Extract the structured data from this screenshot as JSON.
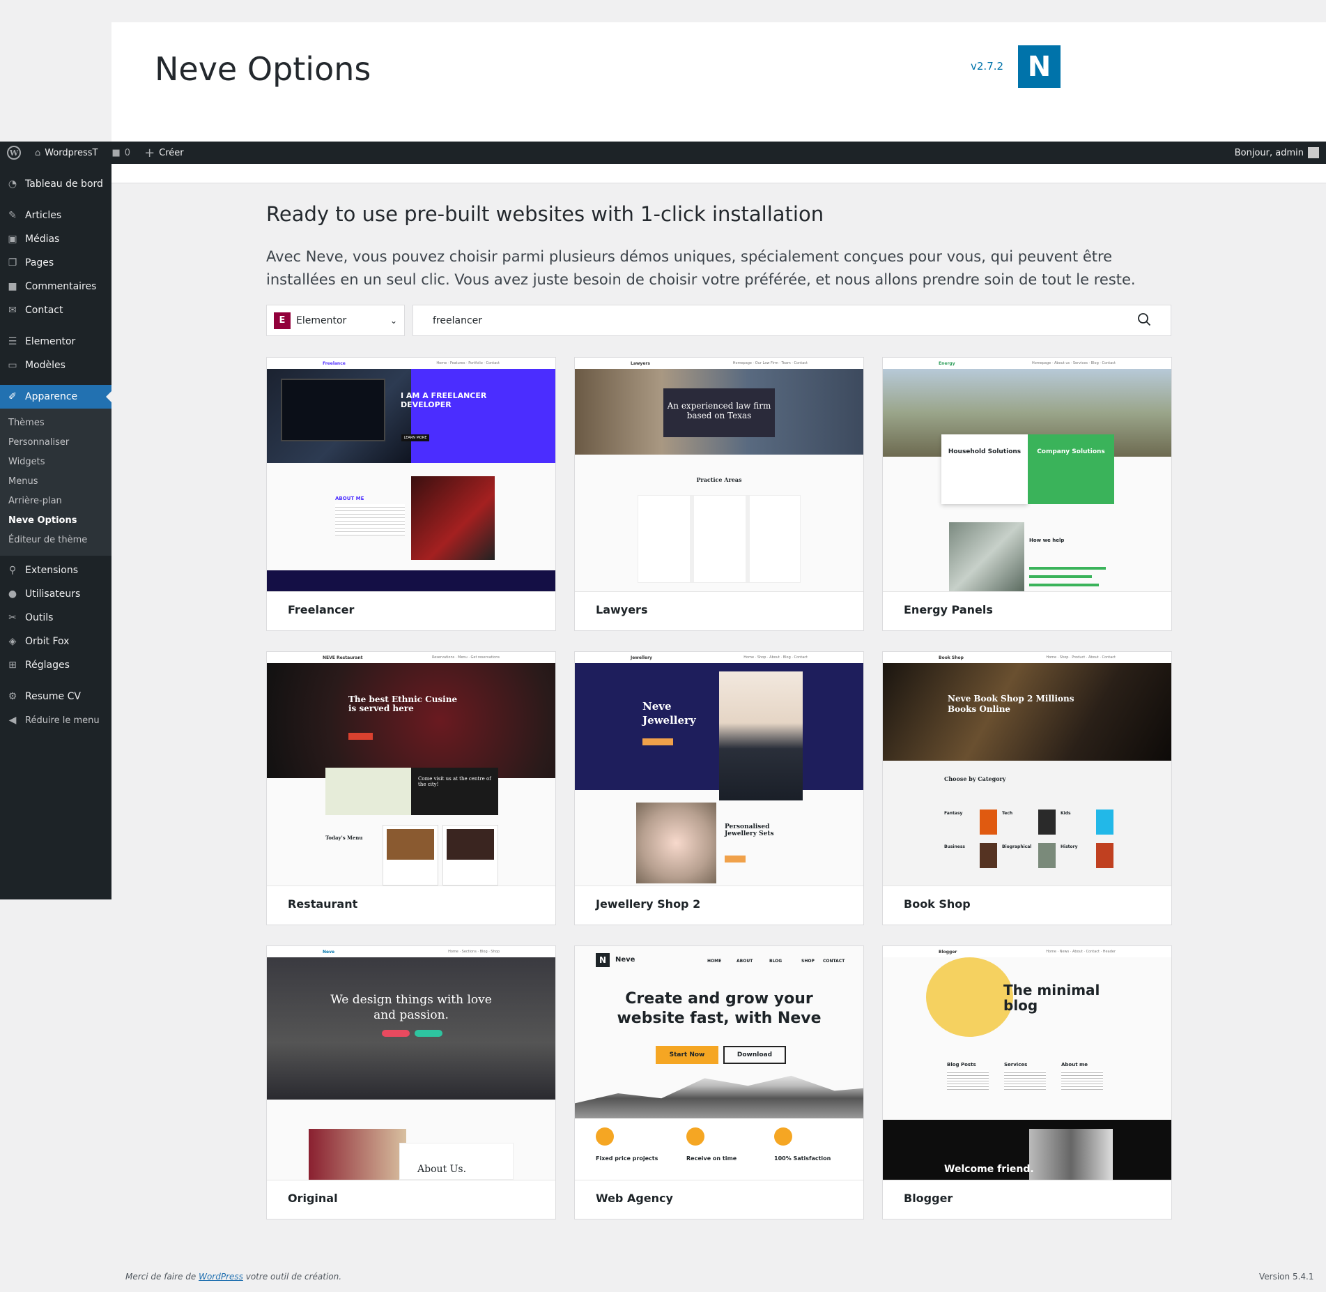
{
  "header": {
    "title": "Neve Options",
    "version": "v2.7.2",
    "logo_letter": "N"
  },
  "adminbar": {
    "site_name": "WordpressT",
    "comments_count": "0",
    "new_label": "Créer",
    "greeting": "Bonjour, admin"
  },
  "sidebar": {
    "items": [
      {
        "label": "Tableau de bord",
        "icon": "dashboard-icon"
      },
      {
        "label": "Articles",
        "icon": "pin-icon"
      },
      {
        "label": "Médias",
        "icon": "media-icon"
      },
      {
        "label": "Pages",
        "icon": "pages-icon"
      },
      {
        "label": "Commentaires",
        "icon": "comment-icon"
      },
      {
        "label": "Contact",
        "icon": "mail-icon"
      },
      {
        "label": "Elementor",
        "icon": "elementor-icon"
      },
      {
        "label": "Modèles",
        "icon": "folder-icon"
      },
      {
        "label": "Apparence",
        "icon": "brush-icon"
      },
      {
        "label": "Extensions",
        "icon": "plugin-icon"
      },
      {
        "label": "Utilisateurs",
        "icon": "user-icon"
      },
      {
        "label": "Outils",
        "icon": "wrench-icon"
      },
      {
        "label": "Orbit Fox",
        "icon": "fox-icon"
      },
      {
        "label": "Réglages",
        "icon": "settings-icon"
      },
      {
        "label": "Resume CV",
        "icon": "gear-icon"
      },
      {
        "label": "Réduire le menu",
        "icon": "collapse-icon"
      }
    ],
    "submenu": [
      "Thèmes",
      "Personnaliser",
      "Widgets",
      "Menus",
      "Arrière-plan",
      "Neve Options",
      "Éditeur de thème"
    ]
  },
  "main": {
    "heading": "Ready to use pre-built websites with 1-click installation",
    "description": "Avec Neve, vous pouvez choisir parmi plusieurs démos uniques, spécialement conçues pour vous, qui peuvent être installées en un seul clic. Vous avez juste besoin de choisir votre préférée, et nous allons prendre soin de tout le reste.",
    "builder": "Elementor",
    "search_value": "freelancer"
  },
  "cards": [
    {
      "title": "Freelancer"
    },
    {
      "title": "Lawyers"
    },
    {
      "title": "Energy Panels"
    },
    {
      "title": "Restaurant"
    },
    {
      "title": "Jewellery Shop 2"
    },
    {
      "title": "Book Shop"
    },
    {
      "title": "Original"
    },
    {
      "title": "Web Agency"
    },
    {
      "title": "Blogger"
    }
  ],
  "previews": {
    "freelancer": {
      "brand": "Freelance",
      "hero": "I AM A FREELANCER DEVELOPER",
      "btn": "LEARN MORE",
      "about": "ABOUT ME"
    },
    "lawyers": {
      "brand": "Lawyers",
      "hero": "An experienced law firm based on Texas",
      "section": "Practice Areas"
    },
    "energy": {
      "brand": "Energy",
      "card1": "Household Solutions",
      "card2": "Company Solutions",
      "help": "How we help"
    },
    "restaurant": {
      "brand": "NEVE Restaurant",
      "hero": "The best Ethnic Cusine is served here",
      "visit": "Come visit us at the centre of the city!",
      "menu": "Today's Menu"
    },
    "jewellery": {
      "brand": "Jewellery",
      "hero": "Neve Jewellery",
      "sets": "Personalised Jewellery Sets"
    },
    "bookshop": {
      "brand": "Book Shop",
      "hero": "Neve Book Shop 2 Millions Books Online",
      "category": "Choose by Category",
      "cats": [
        "Fantasy",
        "Tech",
        "Kids",
        "Business",
        "Biographical",
        "History"
      ]
    },
    "original": {
      "brand": "Neve",
      "hero": "We design things with love and passion.",
      "about": "About Us."
    },
    "agency": {
      "brand": "Neve",
      "nav": [
        "HOME",
        "ABOUT",
        "BLOG",
        "SHOP",
        "CONTACT"
      ],
      "hero": "Create and grow your website fast, with Neve",
      "start": "Start Now",
      "download": "Download",
      "features": [
        "Fixed price projects",
        "Receive on time",
        "100% Satisfaction"
      ]
    },
    "blogger": {
      "brand": "Blogger",
      "hero": "The minimal blog",
      "cols": [
        "Blog Posts",
        "Services",
        "About me"
      ],
      "welcome": "Welcome friend."
    }
  },
  "footer": {
    "thanks_prefix": "Merci de faire de ",
    "thanks_link": "WordPress",
    "thanks_suffix": " votre outil de création.",
    "version": "Version 5.4.1"
  },
  "colors": {
    "accent": "#2271b1",
    "admin_dark": "#1d2327",
    "neve_blue": "#0073aa"
  }
}
